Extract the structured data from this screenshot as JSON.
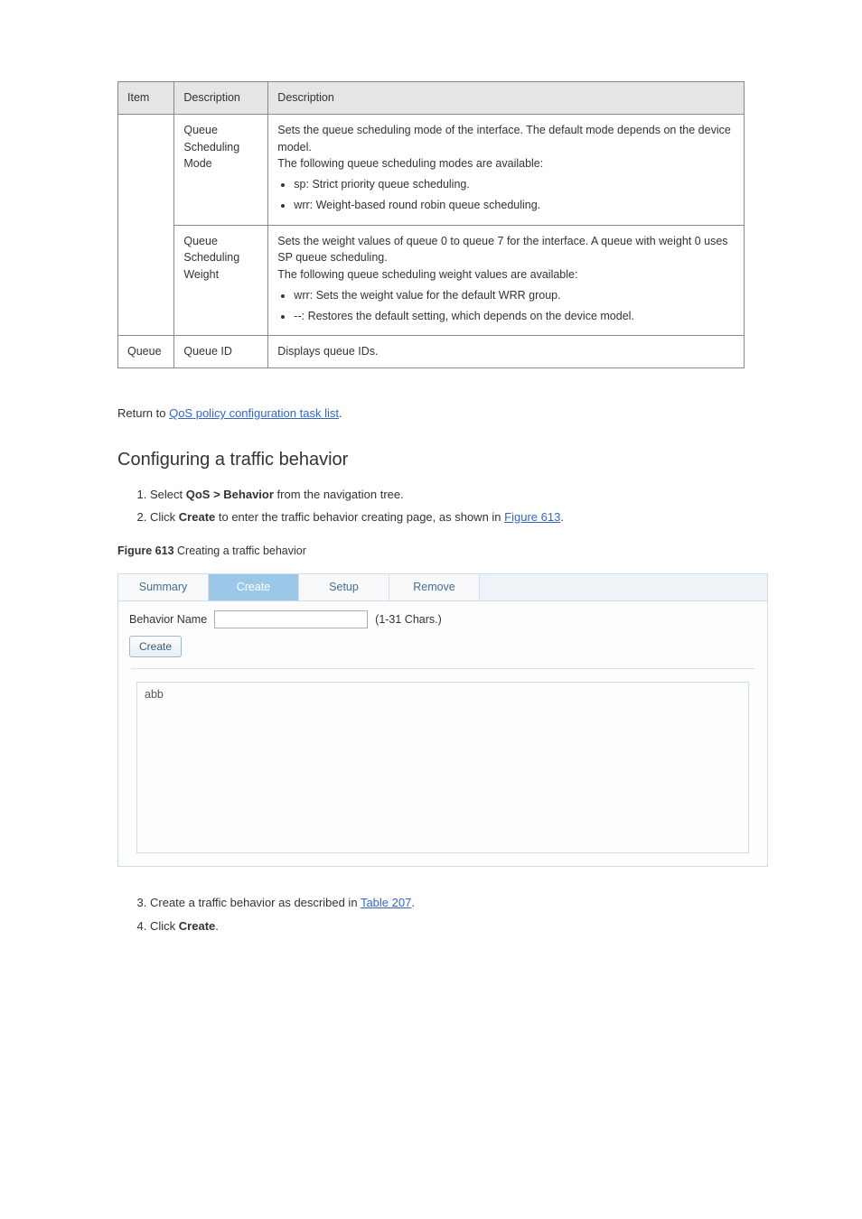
{
  "table": {
    "headers": [
      "Item",
      "Description",
      "Description"
    ],
    "rows": [
      {
        "item": "",
        "desc": "Queue Scheduling Mode",
        "detail_lead": "Sets the queue scheduling mode of the interface. The default mode depends on the device model.",
        "detail_sub": "The following queue scheduling modes are available:",
        "bullets": [
          "sp: Strict priority queue scheduling.",
          "wrr: Weight-based round robin queue scheduling."
        ]
      },
      {
        "item": "",
        "desc": "Queue Scheduling Weight",
        "detail_lead": "Sets the weight values of queue 0 to queue 7 for the interface. A queue with weight 0 uses SP queue scheduling.",
        "detail_sub": "The following queue scheduling weight values are available:",
        "bullets": [
          "wrr: Sets the weight value for the default WRR group.",
          "--: Restores the default setting, which depends on the device model."
        ]
      }
    ],
    "last_row": {
      "item": "Queue",
      "desc": "Queue ID",
      "detail": "Displays queue IDs."
    }
  },
  "return_link_lead": "Return to ",
  "return_link_text": "QoS policy configuration task list",
  "return_link_tail": ".",
  "section_title": "Configuring a traffic behavior",
  "step1_lead": "Select ",
  "step1_menu": "QoS > Behavior",
  "step1_tail": " from the navigation tree.",
  "step2_lead": "Click ",
  "step2_bold": "Create",
  "step2_tail": " to enter the traffic behavior creating page, as shown in ",
  "step2_figlink": "Figure 613",
  "step2_dot": ".",
  "tabs": {
    "summary": "Summary",
    "create": "Create",
    "setup": "Setup",
    "remove": "Remove"
  },
  "form": {
    "label": "Behavior Name",
    "hint": "(1-31 Chars.)",
    "create_btn": "Create",
    "list_item": "abb"
  },
  "figure_caption_strong": "Figure 613 ",
  "figure_caption_rest": "Creating a traffic behavior",
  "step3_lead": "Create a traffic behavior as described in ",
  "step3_link": "Table 207",
  "step3_dot": ".",
  "step4_lead": "Click ",
  "step4_bold": "Create",
  "step4_tail": "."
}
